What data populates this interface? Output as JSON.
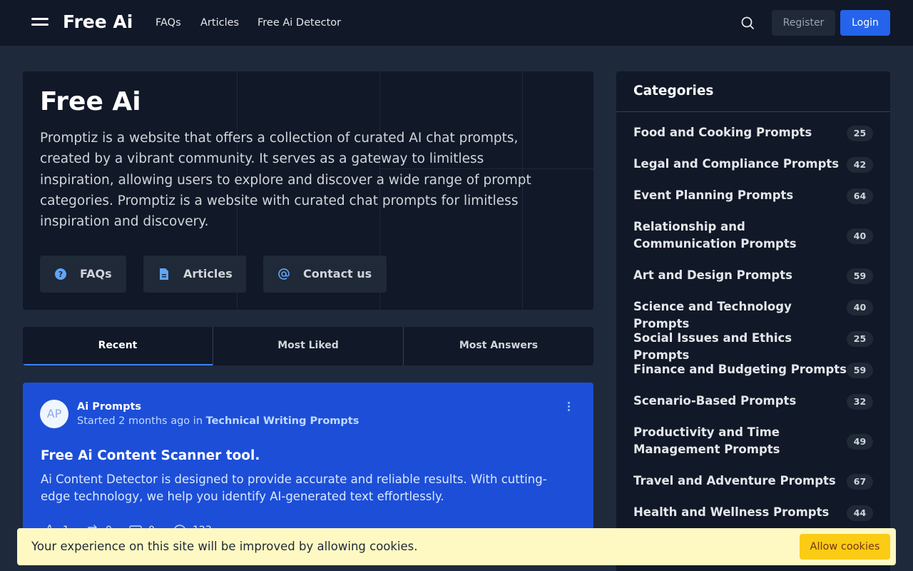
{
  "header": {
    "brand": "Free Ai",
    "nav": [
      "FAQs",
      "Articles",
      "Free Ai Detector"
    ],
    "search_icon": "search-icon",
    "register_label": "Register",
    "login_label": "Login"
  },
  "hero": {
    "title": "Free Ai",
    "description": "Promptiz is a website that offers a collection of curated AI chat prompts, created by a vibrant community. It serves as a gateway to limitless inspiration, allowing users to explore and discover a wide range of prompt categories. Promptiz is a website with curated chat prompts for limitless inspiration and discovery.",
    "buttons": [
      {
        "label": "FAQs",
        "icon": "question-circle-icon"
      },
      {
        "label": "Articles",
        "icon": "document-icon"
      },
      {
        "label": "Contact us",
        "icon": "at-sign-icon"
      }
    ]
  },
  "tabs": [
    "Recent",
    "Most Liked",
    "Most Answers"
  ],
  "post": {
    "avatar_initials": "AP",
    "author": "Ai Prompts",
    "meta_prefix": "Started 2 months ago in",
    "category": "Technical Writing Prompts",
    "title": "Free Ai Content Scanner tool.",
    "excerpt": "Ai Content Detector is designed to provide accurate and reliable results. With cutting-edge technology, we help you identify AI-generated text effortlessly.",
    "stats": [
      "1",
      "0",
      "0",
      "123"
    ]
  },
  "sidebar": {
    "title": "Categories",
    "items": [
      {
        "name": "Food and Cooking Prompts",
        "count": "25"
      },
      {
        "name": "Legal and Compliance Prompts",
        "count": "42"
      },
      {
        "name": "Event Planning Prompts",
        "count": "64"
      },
      {
        "name": "Relationship and Communication Prompts",
        "count": "40"
      },
      {
        "name": "Art and Design Prompts",
        "count": "59"
      },
      {
        "name": "Science and Technology Prompts",
        "count": "40"
      },
      {
        "name": "Social Issues and Ethics Prompts",
        "count": "25"
      },
      {
        "name": "Finance and Budgeting Prompts",
        "count": "59"
      },
      {
        "name": "Scenario-Based Prompts",
        "count": "32"
      },
      {
        "name": "Productivity and Time Management Prompts",
        "count": "49"
      },
      {
        "name": "Travel and Adventure Prompts",
        "count": "67"
      },
      {
        "name": "Health and Wellness Prompts",
        "count": "44"
      }
    ]
  },
  "cookie": {
    "text": "Your experience on this site will be improved by allowing cookies.",
    "button": "Allow cookies"
  },
  "colors": {
    "header_bg": "#111827",
    "page_bg": "#1e293b",
    "primary": "#2563eb",
    "post_bg": "#1d4ed8",
    "cookie_bg": "#fef9c3",
    "cookie_button": "#facc15",
    "icon_accent": "#60a5fa"
  }
}
